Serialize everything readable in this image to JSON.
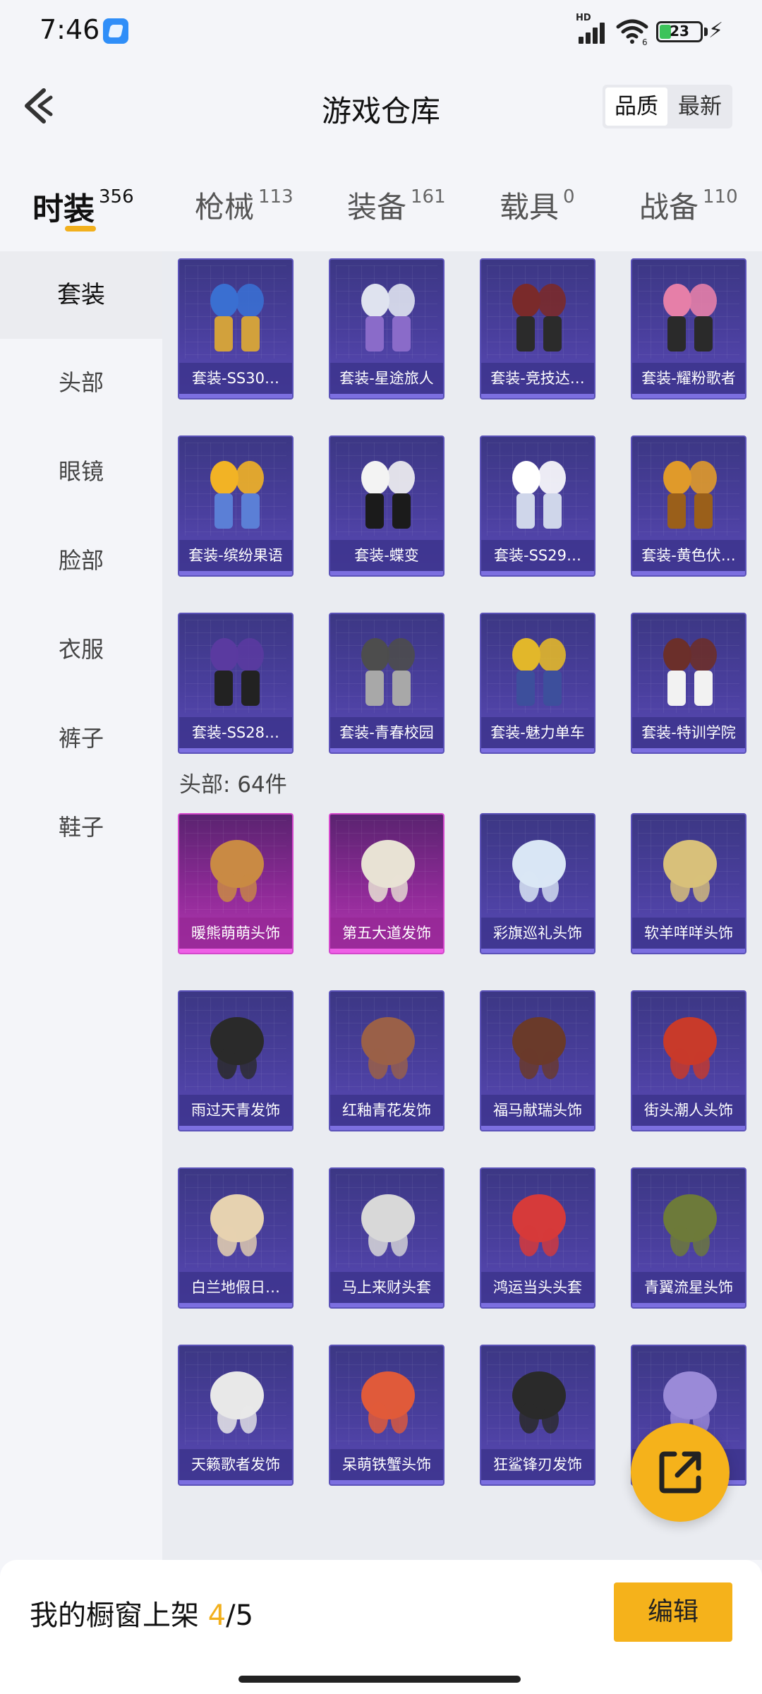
{
  "status_bar": {
    "time": "7:46",
    "network_label": "HD",
    "battery_level": "23",
    "icons": [
      "app-notification-icon",
      "signal-icon",
      "wifi-icon",
      "battery-icon",
      "charging-icon"
    ]
  },
  "header": {
    "title": "游戏仓库",
    "sort_options": [
      "品质",
      "最新"
    ],
    "sort_selected": "品质"
  },
  "tabs": [
    {
      "label": "时装",
      "count": "356",
      "active": true
    },
    {
      "label": "枪械",
      "count": "113",
      "active": false
    },
    {
      "label": "装备",
      "count": "161",
      "active": false
    },
    {
      "label": "载具",
      "count": "0",
      "active": false
    },
    {
      "label": "战备",
      "count": "110",
      "active": false
    }
  ],
  "sidebar": {
    "items": [
      {
        "label": "套装",
        "active": true
      },
      {
        "label": "头部",
        "active": false
      },
      {
        "label": "眼镜",
        "active": false
      },
      {
        "label": "脸部",
        "active": false
      },
      {
        "label": "衣服",
        "active": false
      },
      {
        "label": "裤子",
        "active": false
      },
      {
        "label": "鞋子",
        "active": false
      }
    ]
  },
  "content": {
    "suits": [
      "套装-SS30…",
      "套装-星途旅人",
      "套装-竞技达…",
      "套装-耀粉歌者",
      "套装-缤纷果语",
      "套装-蝶变",
      "套装-SS29…",
      "套装-黄色伏…",
      "套装-SS28…",
      "套装-青春校园",
      "套装-魅力单车",
      "套装-特训学院"
    ],
    "head_section_label": "头部: 64件",
    "head_items": [
      {
        "name": "暖熊萌萌头饰",
        "tier": "pink"
      },
      {
        "name": "第五大道发饰",
        "tier": "pink"
      },
      {
        "name": "彩旗巡礼头饰",
        "tier": "purple"
      },
      {
        "name": "软羊咩咩头饰",
        "tier": "purple"
      },
      {
        "name": "雨过天青发饰",
        "tier": "purple"
      },
      {
        "name": "红釉青花发饰",
        "tier": "purple"
      },
      {
        "name": "福马献瑞头饰",
        "tier": "purple"
      },
      {
        "name": "街头潮人头饰",
        "tier": "purple"
      },
      {
        "name": "白兰地假日…",
        "tier": "purple"
      },
      {
        "name": "马上来财头套",
        "tier": "purple"
      },
      {
        "name": "鸿运当头头套",
        "tier": "purple"
      },
      {
        "name": "青翼流星头饰",
        "tier": "purple"
      },
      {
        "name": "天籁歌者发饰",
        "tier": "purple"
      },
      {
        "name": "呆萌铁蟹头饰",
        "tier": "purple"
      },
      {
        "name": "狂鲨锋刃发饰",
        "tier": "purple"
      },
      {
        "name": "",
        "tier": "purple"
      }
    ]
  },
  "fab": {
    "icon": "share-external-icon"
  },
  "bottom_bar": {
    "shelf_prefix": "我的橱窗上架 ",
    "shelf_current": "4",
    "shelf_total": "/5",
    "edit_label": "编辑"
  },
  "colors": {
    "accent": "#f5b21b",
    "card_purple": "#4a3f9e",
    "card_pink": "#b638b2"
  }
}
